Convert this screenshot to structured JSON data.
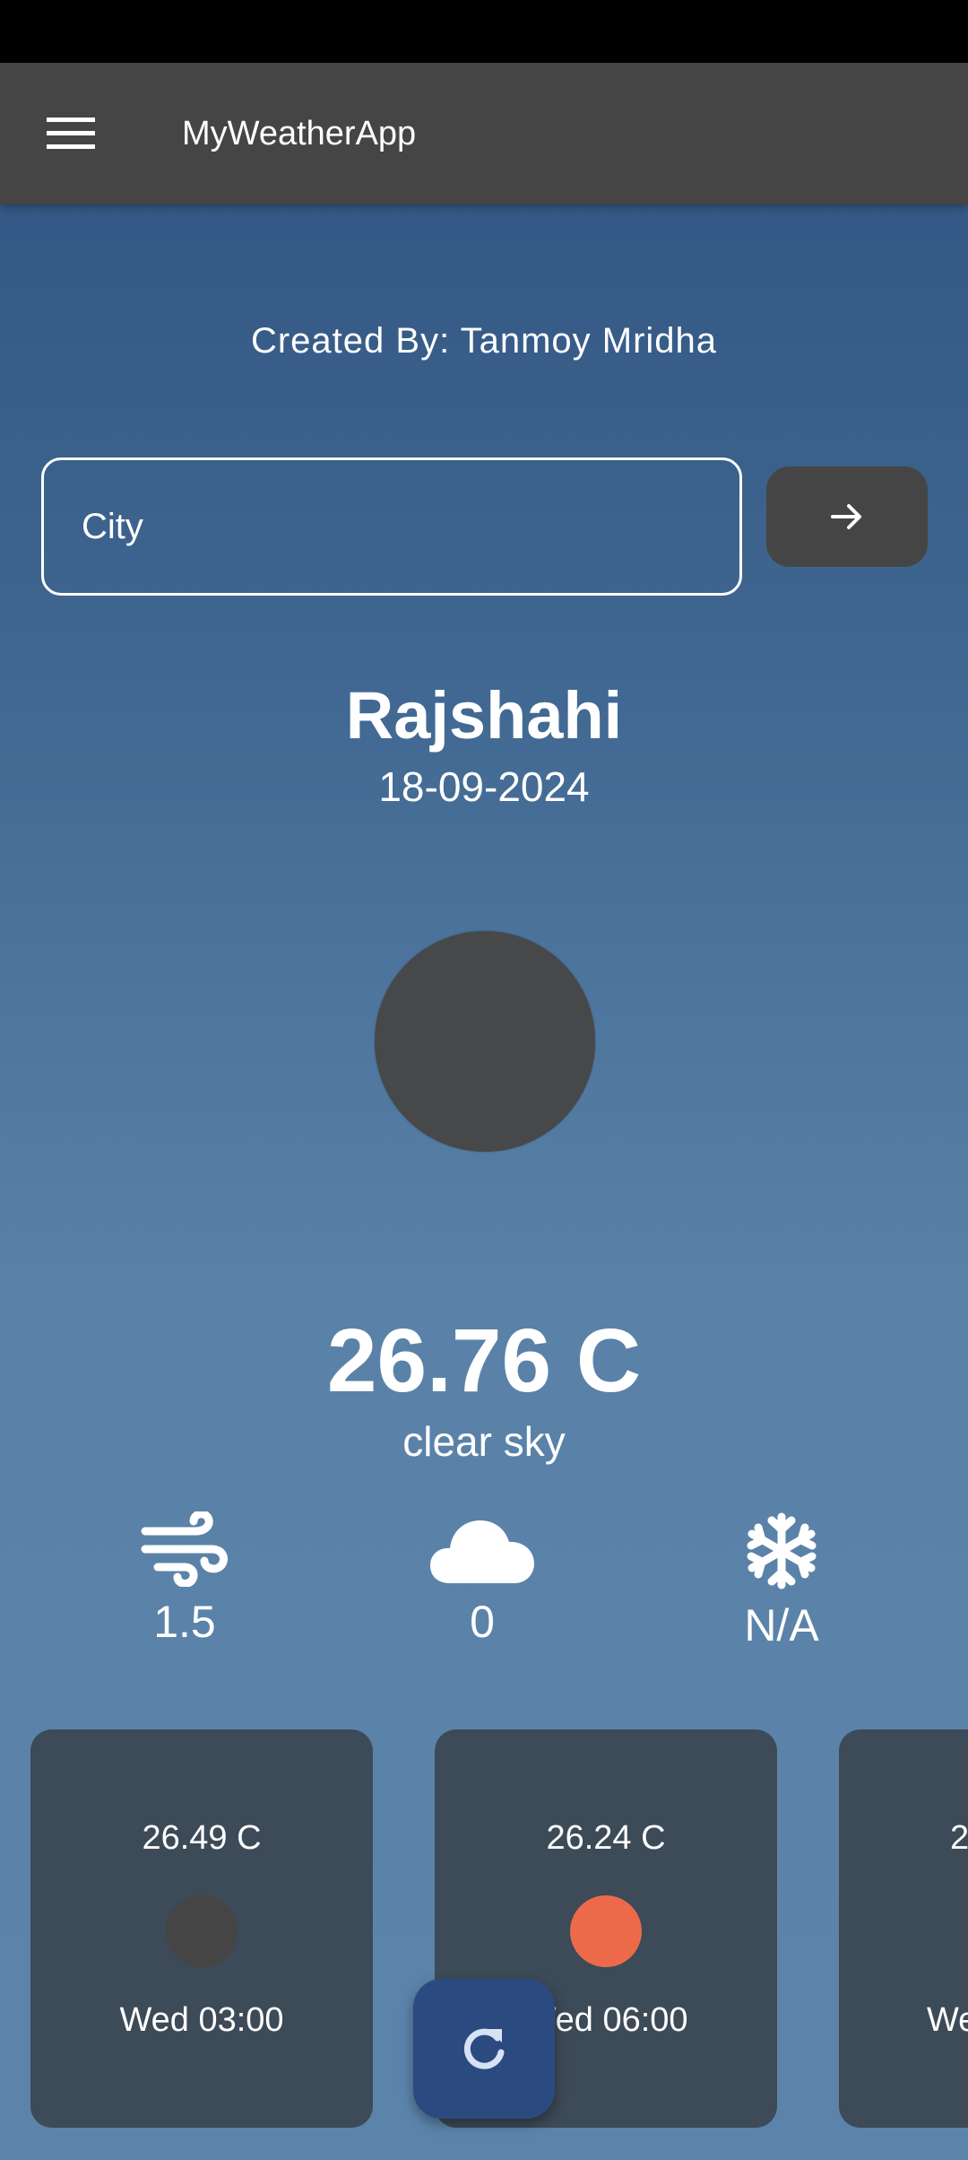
{
  "app_bar": {
    "title": "MyWeatherApp",
    "menu_icon": "hamburger-menu-icon"
  },
  "credit": "Created By: Tanmoy Mridha",
  "search": {
    "placeholder": "City",
    "value": "",
    "submit_icon": "arrow-right-icon"
  },
  "current": {
    "city": "Rajshahi",
    "date": "18-09-2024",
    "temperature": "26.76 C",
    "condition": "clear sky"
  },
  "stats": [
    {
      "icon": "wind-icon",
      "value": "1.5"
    },
    {
      "icon": "cloud-icon",
      "value": "0"
    },
    {
      "icon": "snowflake-icon",
      "value": "N/A"
    }
  ],
  "forecast": [
    {
      "temp": "26.49 C",
      "time": "Wed 03:00",
      "icon_color": "#454545"
    },
    {
      "temp": "26.24 C",
      "time": "Wed 06:00",
      "icon_color": "#ec6a4a"
    },
    {
      "temp": "2",
      "time": "We",
      "icon_color": "#454545"
    }
  ],
  "fab_icon": "refresh-icon",
  "colors": {
    "app_bar": "#454545",
    "card": "#3d4a57",
    "fab": "#2b4a80",
    "sun": "#ec6a4a"
  }
}
